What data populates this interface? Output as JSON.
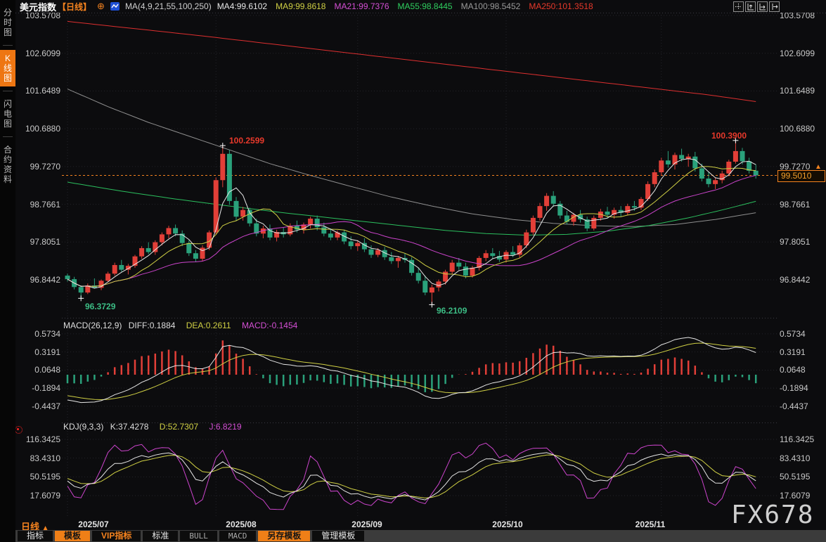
{
  "sidebar": {
    "tabs": [
      {
        "label": "分时图",
        "active": false
      },
      {
        "label": "K线图",
        "active": true
      },
      {
        "label": "闪电图",
        "active": false
      },
      {
        "label": "合约资料",
        "active": false
      }
    ]
  },
  "header": {
    "title": "美元指数",
    "period_tag": "【日线】",
    "add_icon": "circle-plus-icon",
    "chart_type_icon": "candlestick-chart-icon",
    "ma_label": "MA(4,9,21,55,100,250)",
    "ma_values": [
      {
        "label": "MA4:99.6102",
        "color": "#e6e6e6"
      },
      {
        "label": "MA9:99.8618",
        "color": "#d0d044"
      },
      {
        "label": "MA21:99.7376",
        "color": "#d44fd4"
      },
      {
        "label": "MA55:98.8445",
        "color": "#2fcf5f"
      },
      {
        "label": "MA100:98.5452",
        "color": "#9a9a9a"
      },
      {
        "label": "MA250:101.3518",
        "color": "#e8392b"
      }
    ],
    "top_right_icons": [
      "crosshair-icon",
      "y-axis-scale-icon",
      "x-axis-scale-icon",
      "pan-right-icon"
    ]
  },
  "main_chart": {
    "y_ticks": [
      "103.5708",
      "102.6099",
      "101.6489",
      "100.6880",
      "99.7270",
      "98.7661",
      "97.8051",
      "96.8442"
    ],
    "price_tag": "99.5010",
    "price_line_value": 99.501
  },
  "macd_panel": {
    "header_label": "MACD(26,12,9)",
    "diff_label": "DIFF:0.1884",
    "dea_label": "DEA:0.2611",
    "macd_label": "MACD:-0.1454",
    "y_ticks": [
      "0.5734",
      "0.3191",
      "0.0648",
      "-0.1894",
      "-0.4437"
    ]
  },
  "kdj_panel": {
    "header_label": "KDJ(9,3,3)",
    "k_label": "K:37.4278",
    "d_label": "D:52.7307",
    "j_label": "J:6.8219",
    "y_ticks": [
      "116.3425",
      "83.4310",
      "50.5195",
      "17.6079"
    ]
  },
  "x_axis": {
    "period_label": "日线",
    "dates": [
      "2025/07",
      "2025/08",
      "2025/09",
      "2025/10",
      "2025/11"
    ]
  },
  "bottom_toolbar": {
    "buttons": [
      {
        "label": "指标",
        "style": "plain"
      },
      {
        "label": "模板",
        "style": "orange"
      },
      {
        "label": "VIP指标",
        "style": "orange-text"
      },
      {
        "label": "标准",
        "style": "plain"
      },
      {
        "label": "BULL",
        "style": "mono"
      },
      {
        "label": "MACD",
        "style": "mono"
      },
      {
        "label": "另存模板",
        "style": "orange"
      },
      {
        "label": "管理模板",
        "style": "plain"
      }
    ]
  },
  "watermark": "FX678",
  "colors": {
    "up": "#e23f38",
    "down": "#2aa17b",
    "accent_orange": "#f5831f",
    "ma4": "#e6e6e6",
    "ma9": "#d0d044",
    "ma21": "#cc44cc",
    "ma55": "#2bbf5e",
    "ma100": "#8e8e8e",
    "ma250": "#dd2f2f",
    "diff": "#e6e6e6",
    "dea": "#d0d044",
    "k": "#e6e6e6",
    "d": "#d0d044",
    "j": "#cc44cc"
  },
  "chart_data": {
    "type": "candlestick",
    "symbol": "美元指数",
    "period": "日线",
    "x_months": [
      "2025/07",
      "2025/08",
      "2025/09",
      "2025/10",
      "2025/11"
    ],
    "ylim_main": [
      96.09,
      103.66
    ],
    "ma_params": [
      4,
      9,
      21,
      55,
      100,
      250
    ],
    "macd_params": [
      26,
      12,
      9
    ],
    "kdj_params": [
      9,
      3,
      3
    ],
    "last_close": 99.501,
    "candles": [
      [
        96.95,
        97.0,
        96.8,
        96.86
      ],
      [
        96.86,
        96.92,
        96.6,
        96.66
      ],
      [
        96.66,
        96.7,
        96.37,
        96.52
      ],
      [
        96.52,
        96.75,
        96.48,
        96.7
      ],
      [
        96.7,
        96.88,
        96.62,
        96.64
      ],
      [
        96.64,
        96.85,
        96.58,
        96.82
      ],
      [
        96.82,
        97.05,
        96.78,
        97.0
      ],
      [
        97.0,
        97.28,
        96.95,
        97.22
      ],
      [
        97.22,
        97.35,
        97.05,
        97.1
      ],
      [
        97.1,
        97.25,
        96.98,
        97.2
      ],
      [
        97.2,
        97.48,
        97.15,
        97.44
      ],
      [
        97.44,
        97.7,
        97.38,
        97.65
      ],
      [
        97.65,
        97.8,
        97.5,
        97.55
      ],
      [
        97.55,
        97.85,
        97.48,
        97.8
      ],
      [
        97.8,
        98.05,
        97.72,
        98.0
      ],
      [
        98.0,
        98.22,
        97.9,
        98.16
      ],
      [
        98.16,
        98.25,
        97.95,
        98.02
      ],
      [
        98.02,
        98.1,
        97.7,
        97.78
      ],
      [
        97.78,
        97.85,
        97.45,
        97.52
      ],
      [
        97.52,
        97.6,
        97.3,
        97.38
      ],
      [
        97.38,
        97.72,
        97.32,
        97.66
      ],
      [
        97.66,
        98.1,
        97.6,
        98.05
      ],
      [
        98.05,
        99.45,
        98.0,
        99.38
      ],
      [
        99.38,
        100.26,
        99.2,
        100.05
      ],
      [
        100.05,
        100.15,
        98.75,
        98.85
      ],
      [
        98.85,
        98.95,
        98.35,
        98.45
      ],
      [
        98.45,
        98.7,
        98.35,
        98.62
      ],
      [
        98.62,
        98.68,
        98.2,
        98.28
      ],
      [
        98.28,
        98.4,
        97.95,
        98.02
      ],
      [
        98.02,
        98.22,
        97.9,
        98.15
      ],
      [
        98.15,
        98.25,
        97.85,
        97.92
      ],
      [
        97.92,
        98.12,
        97.82,
        98.06
      ],
      [
        98.06,
        98.18,
        97.92,
        98.0
      ],
      [
        98.0,
        98.28,
        97.95,
        98.22
      ],
      [
        98.22,
        98.35,
        98.05,
        98.12
      ],
      [
        98.12,
        98.3,
        98.02,
        98.25
      ],
      [
        98.25,
        98.45,
        98.15,
        98.4
      ],
      [
        98.4,
        98.48,
        98.1,
        98.18
      ],
      [
        98.18,
        98.3,
        97.95,
        98.02
      ],
      [
        98.02,
        98.15,
        97.85,
        97.92
      ],
      [
        97.92,
        98.1,
        97.85,
        98.05
      ],
      [
        98.05,
        98.12,
        97.75,
        97.82
      ],
      [
        97.82,
        97.95,
        97.62,
        97.7
      ],
      [
        97.7,
        97.85,
        97.58,
        97.78
      ],
      [
        97.78,
        97.9,
        97.55,
        97.62
      ],
      [
        97.62,
        97.72,
        97.4,
        97.48
      ],
      [
        97.48,
        97.65,
        97.42,
        97.6
      ],
      [
        97.6,
        97.68,
        97.35,
        97.42
      ],
      [
        97.42,
        97.55,
        97.25,
        97.32
      ],
      [
        97.32,
        97.45,
        97.15,
        97.4
      ],
      [
        97.4,
        97.52,
        97.28,
        97.35
      ],
      [
        97.35,
        97.42,
        96.95,
        97.02
      ],
      [
        97.02,
        97.15,
        96.75,
        96.82
      ],
      [
        96.82,
        96.95,
        96.45,
        96.52
      ],
      [
        96.52,
        96.72,
        96.21,
        96.65
      ],
      [
        96.65,
        96.85,
        96.55,
        96.8
      ],
      [
        96.8,
        97.1,
        96.72,
        97.05
      ],
      [
        97.05,
        97.35,
        96.98,
        97.28
      ],
      [
        97.28,
        97.4,
        97.1,
        97.18
      ],
      [
        97.18,
        97.28,
        96.88,
        96.95
      ],
      [
        96.95,
        97.2,
        96.9,
        97.15
      ],
      [
        97.15,
        97.45,
        97.08,
        97.4
      ],
      [
        97.4,
        97.6,
        97.32,
        97.52
      ],
      [
        97.52,
        97.65,
        97.38,
        97.45
      ],
      [
        97.45,
        97.58,
        97.3,
        97.36
      ],
      [
        97.36,
        97.6,
        97.28,
        97.55
      ],
      [
        97.55,
        97.7,
        97.42,
        97.48
      ],
      [
        97.48,
        97.78,
        97.4,
        97.72
      ],
      [
        97.72,
        98.12,
        97.65,
        98.05
      ],
      [
        98.05,
        98.48,
        97.98,
        98.42
      ],
      [
        98.42,
        98.8,
        98.35,
        98.72
      ],
      [
        98.72,
        99.05,
        98.6,
        98.98
      ],
      [
        98.98,
        99.1,
        98.7,
        98.78
      ],
      [
        98.78,
        98.85,
        98.4,
        98.48
      ],
      [
        98.48,
        98.6,
        98.25,
        98.32
      ],
      [
        98.32,
        98.55,
        98.22,
        98.5
      ],
      [
        98.5,
        98.62,
        98.3,
        98.38
      ],
      [
        98.38,
        98.45,
        98.08,
        98.15
      ],
      [
        98.15,
        98.48,
        98.1,
        98.42
      ],
      [
        98.42,
        98.65,
        98.35,
        98.58
      ],
      [
        98.58,
        98.7,
        98.42,
        98.5
      ],
      [
        98.5,
        98.68,
        98.4,
        98.62
      ],
      [
        98.62,
        98.72,
        98.45,
        98.55
      ],
      [
        98.55,
        98.78,
        98.48,
        98.72
      ],
      [
        98.72,
        98.85,
        98.6,
        98.68
      ],
      [
        98.68,
        98.95,
        98.62,
        98.9
      ],
      [
        98.9,
        99.35,
        98.85,
        99.28
      ],
      [
        99.28,
        99.65,
        99.2,
        99.58
      ],
      [
        99.58,
        99.95,
        99.5,
        99.88
      ],
      [
        99.88,
        100.12,
        99.7,
        99.78
      ],
      [
        99.78,
        100.08,
        99.65,
        100.02
      ],
      [
        100.02,
        100.18,
        99.85,
        99.92
      ],
      [
        99.92,
        100.05,
        99.72,
        99.98
      ],
      [
        99.98,
        100.1,
        99.6,
        99.68
      ],
      [
        99.68,
        99.8,
        99.35,
        99.42
      ],
      [
        99.42,
        99.58,
        99.2,
        99.28
      ],
      [
        99.28,
        99.45,
        99.15,
        99.38
      ],
      [
        99.38,
        99.62,
        99.3,
        99.55
      ],
      [
        99.55,
        99.9,
        99.48,
        99.85
      ],
      [
        99.85,
        100.39,
        99.8,
        100.12
      ],
      [
        100.12,
        100.2,
        99.78,
        99.86
      ],
      [
        99.86,
        99.95,
        99.55,
        99.62
      ],
      [
        99.62,
        99.78,
        99.42,
        99.5
      ]
    ],
    "ma55_anchors": [
      [
        0,
        99.33
      ],
      [
        8,
        99.1
      ],
      [
        16,
        98.9
      ],
      [
        24,
        98.72
      ],
      [
        32,
        98.55
      ],
      [
        40,
        98.4
      ],
      [
        48,
        98.25
      ],
      [
        56,
        98.1
      ],
      [
        62,
        98.02
      ],
      [
        68,
        97.98
      ],
      [
        74,
        98.0
      ],
      [
        80,
        98.08
      ],
      [
        86,
        98.22
      ],
      [
        92,
        98.42
      ],
      [
        97,
        98.62
      ],
      [
        102,
        98.84
      ]
    ],
    "ma100_anchors": [
      [
        0,
        101.7
      ],
      [
        6,
        101.25
      ],
      [
        12,
        100.85
      ],
      [
        18,
        100.5
      ],
      [
        24,
        100.15
      ],
      [
        30,
        99.8
      ],
      [
        36,
        99.5
      ],
      [
        42,
        99.22
      ],
      [
        48,
        98.95
      ],
      [
        54,
        98.72
      ],
      [
        60,
        98.52
      ],
      [
        66,
        98.38
      ],
      [
        72,
        98.28
      ],
      [
        78,
        98.22
      ],
      [
        84,
        98.2
      ],
      [
        90,
        98.25
      ],
      [
        96,
        98.38
      ],
      [
        102,
        98.55
      ]
    ],
    "ma250_anchors": [
      [
        0,
        103.42
      ],
      [
        20,
        103.05
      ],
      [
        40,
        102.65
      ],
      [
        60,
        102.25
      ],
      [
        80,
        101.85
      ],
      [
        95,
        101.55
      ],
      [
        102,
        101.38
      ]
    ],
    "annotations": [
      {
        "idx": 23,
        "value": 100.2599,
        "text": "100.2599",
        "type": "high"
      },
      {
        "idx": 2,
        "value": 96.3729,
        "text": "96.3729",
        "type": "low"
      },
      {
        "idx": 54,
        "value": 96.2109,
        "text": "96.2109",
        "type": "low"
      },
      {
        "idx": 99,
        "value": 100.39,
        "text": "100.3900",
        "type": "high"
      }
    ]
  }
}
